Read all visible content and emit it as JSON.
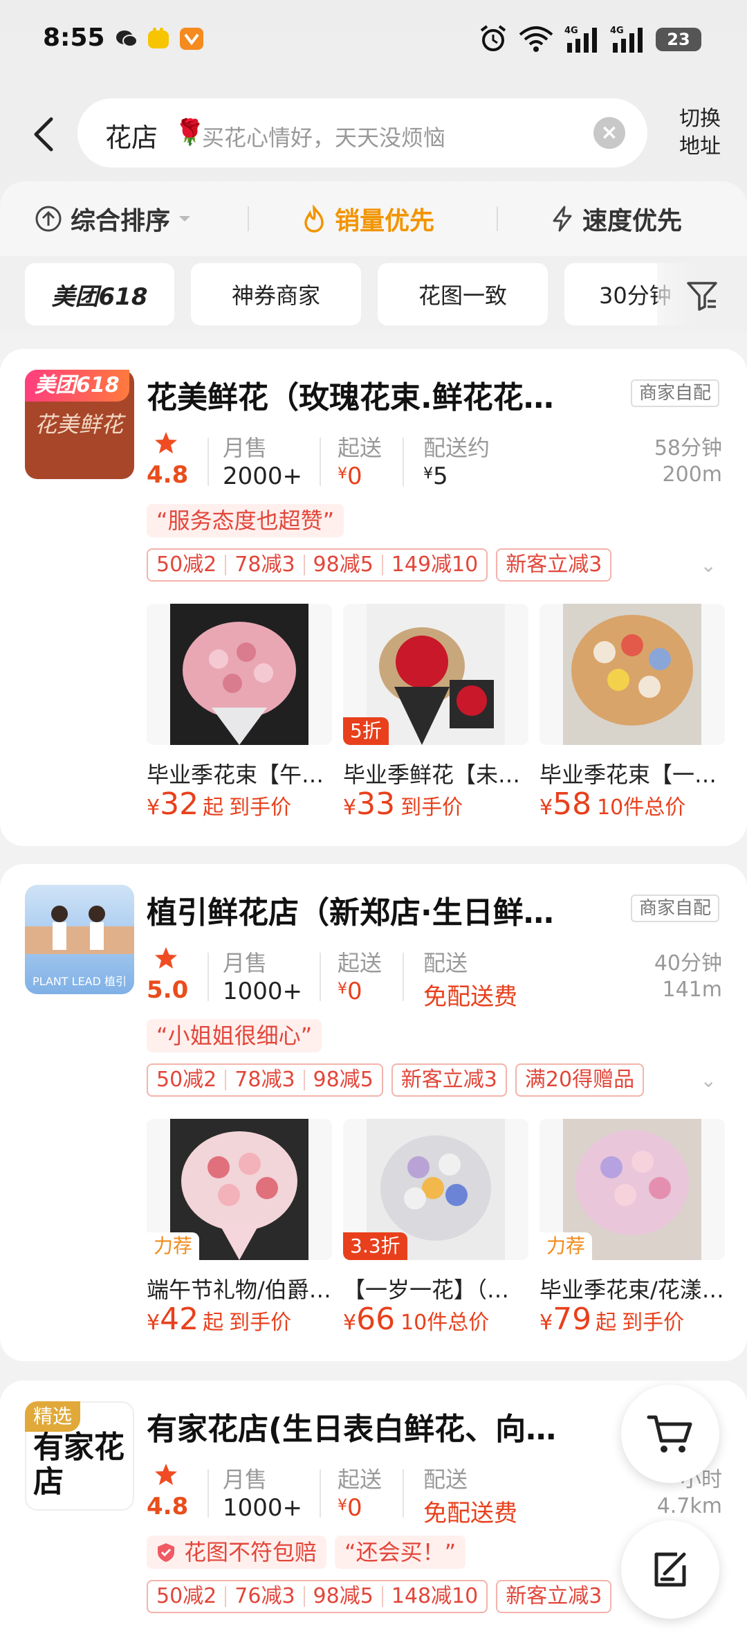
{
  "status_bar": {
    "time": "8:55",
    "battery": "23"
  },
  "search": {
    "keyword": "花店",
    "placeholder": "买花心情好，天天没烦恼",
    "switch_address": "切换\n地址"
  },
  "sort": {
    "items": [
      "综合排序",
      "销量优先",
      "速度优先"
    ],
    "active_color": "#f29400"
  },
  "filters": {
    "chips": [
      "美团618",
      "神券商家",
      "花图一致",
      "30分钟"
    ]
  },
  "shops": [
    {
      "badge": "美团618",
      "logo_text": "花美鲜花",
      "name": "花美鲜花（玫瑰花束.鲜花花…",
      "delivery_tag": "商家自配",
      "rating": "4.8",
      "monthly_label": "月售",
      "monthly": "2000+",
      "min_label": "起送",
      "min": "0",
      "fee_label": "配送约",
      "fee": "5",
      "time": "58分钟",
      "distance": "200m",
      "quote": "“服务态度也超赞”",
      "promos": [
        [
          "50减2",
          "78减3",
          "98减5",
          "149减10"
        ],
        [
          "新客立减3"
        ]
      ],
      "products": [
        {
          "title": "毕业季花束【午…",
          "price": "32",
          "suffix": "起",
          "suffix2": "到手价",
          "tag": ""
        },
        {
          "title": "毕业季鲜花【未…",
          "price": "33",
          "suffix": "",
          "suffix2": "到手价",
          "tag": "5折"
        },
        {
          "title": "毕业季花束【一…",
          "price": "58",
          "suffix": "",
          "suffix2": "10件总价",
          "tag": ""
        }
      ]
    },
    {
      "badge": "",
      "logo_text": "PLANT LEAD 植引",
      "name": "植引鲜花店（新郑店·生日鲜…",
      "delivery_tag": "商家自配",
      "rating": "5.0",
      "monthly_label": "月售",
      "monthly": "1000+",
      "min_label": "起送",
      "min": "0",
      "fee_label": "配送",
      "fee": "免配送费",
      "time": "40分钟",
      "distance": "141m",
      "quote": "“小姐姐很细心”",
      "promos": [
        [
          "50减2",
          "78减3",
          "98减5"
        ],
        [
          "新客立减3"
        ],
        [
          "满20得赠品"
        ]
      ],
      "products": [
        {
          "title": "端午节礼物/伯爵…",
          "price": "42",
          "suffix": "起",
          "suffix2": "到手价",
          "tag": "力荐"
        },
        {
          "title": "【一岁一花】（…",
          "price": "66",
          "suffix": "",
          "suffix2": "10件总价",
          "tag": "3.3折"
        },
        {
          "title": "毕业季花束/花漾…",
          "price": "79",
          "suffix": "起",
          "suffix2": "到手价",
          "tag": "力荐"
        }
      ]
    },
    {
      "badge": "精选",
      "logo_text": "有家花店",
      "name": "有家花店(生日表白鲜花、向…",
      "delivery_tag": "",
      "rating": "4.8",
      "monthly_label": "月售",
      "monthly": "1000+",
      "min_label": "起送",
      "min": "0",
      "fee_label": "配送",
      "fee": "免配送费",
      "time": "小时",
      "distance": "4.7km",
      "guarantee": "花图不符包赔",
      "quote": "“还会买！”",
      "promos": [
        [
          "50减2",
          "76减3",
          "98减5",
          "148减10"
        ],
        [
          "新客立减3"
        ]
      ]
    }
  ],
  "currency": "¥"
}
